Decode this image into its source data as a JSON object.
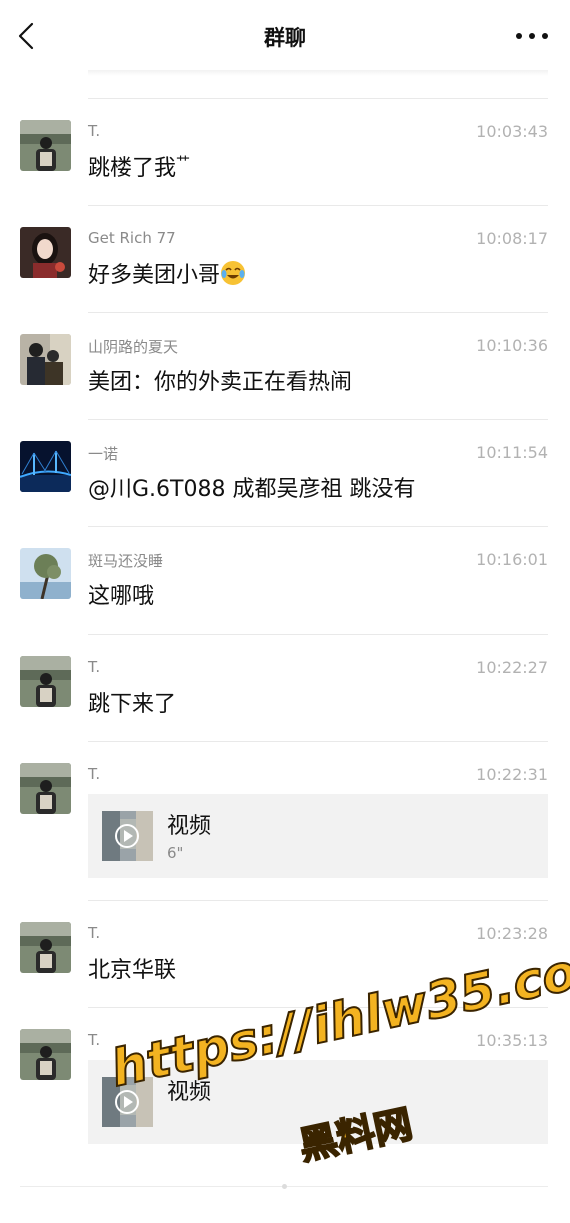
{
  "navbar": {
    "title": "群聊"
  },
  "icons": {
    "back": "chevron-left-icon",
    "more": "more-dots-icon",
    "play": "play-icon",
    "emoji": "tears-of-joy-emoji"
  },
  "messages": [
    {
      "sender": "T.",
      "time": "10:03:43",
      "text": "跳楼了我",
      "trailing_glyph": "艹"
    },
    {
      "sender": "Get Rich 77",
      "time": "10:08:17",
      "text": "好多美团小哥"
    },
    {
      "sender": "山阴路的夏天",
      "time": "10:10:36",
      "text": "美团：你的外卖正在看热闹"
    },
    {
      "sender": "一诺",
      "time": "10:11:54",
      "text": "@川G.6T088 成都吴彦祖 跳没有"
    },
    {
      "sender": "斑马还没睡",
      "time": "10:16:01",
      "text": "这哪哦"
    },
    {
      "sender": "T.",
      "time": "10:22:27",
      "text": "跳下来了"
    },
    {
      "sender": "T.",
      "time": "10:22:31",
      "video": {
        "title": "视频",
        "duration": "6\""
      }
    },
    {
      "sender": "T.",
      "time": "10:23:28",
      "text": "北京华联"
    },
    {
      "sender": "T.",
      "time": "10:35:13",
      "video": {
        "title": "视频",
        "duration": ""
      }
    }
  ],
  "watermark": {
    "url": "https://ihlw35.com",
    "name": "黑料网"
  },
  "colors": {
    "sender": "#8a8a8a",
    "time": "#b2b2b2",
    "divider": "#e9e9e9",
    "card": "#f2f2f2",
    "watermark": "#f3b321"
  }
}
